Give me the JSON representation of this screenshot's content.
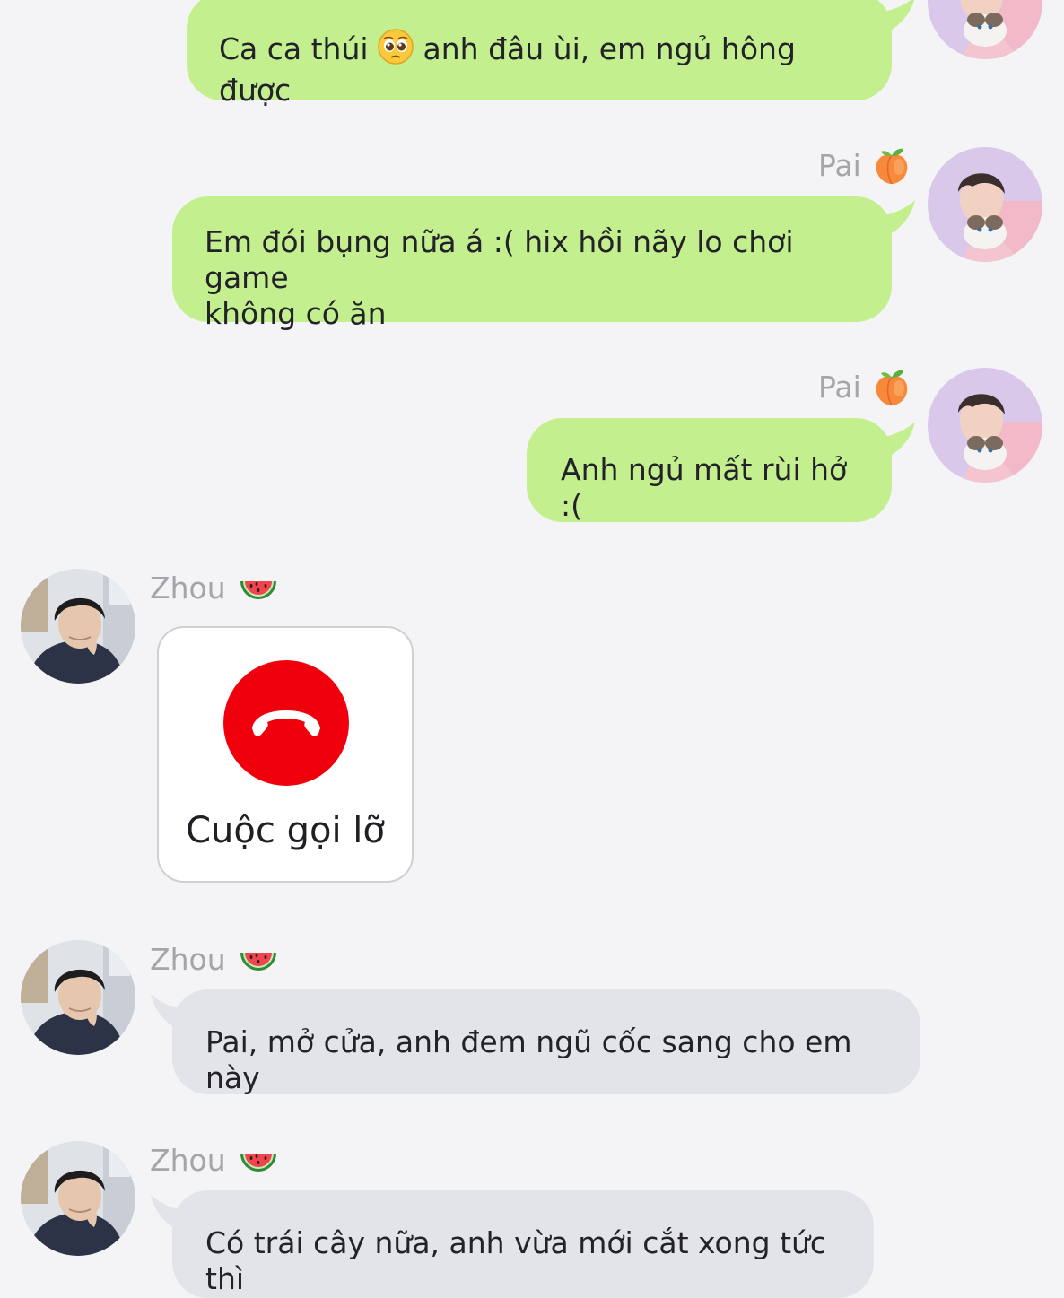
{
  "messages": [
    {
      "side": "outgoing",
      "text_before_emoji": "Ca ca thúi ",
      "emoji": "pleading-face-emoji",
      "text_after_emoji": " anh đâu ùi, em ngủ hông được"
    },
    {
      "side": "outgoing",
      "sender_name": "Pai",
      "sender_emoji": "peach-emoji",
      "text": "Em đói bụng nữa á :( hix hồi nãy lo chơi game\nkhông có ăn"
    },
    {
      "side": "outgoing",
      "sender_name": "Pai",
      "sender_emoji": "peach-emoji",
      "text": "Anh ngủ mất rùi hở :("
    },
    {
      "side": "incoming",
      "sender_name": "Zhou",
      "sender_emoji": "watermelon-emoji",
      "type": "missed_call",
      "call_label": "Cuộc gọi lỡ",
      "call_icon": "phone-hangup-icon",
      "call_icon_color": "#f0000c"
    },
    {
      "side": "incoming",
      "sender_name": "Zhou",
      "sender_emoji": "watermelon-emoji",
      "text": "Pai, mở cửa, anh đem ngũ cốc sang cho em này"
    },
    {
      "side": "incoming",
      "sender_name": "Zhou",
      "sender_emoji": "watermelon-emoji",
      "text": "Có trái cây nữa, anh vừa mới cắt xong tức thì"
    }
  ],
  "colors": {
    "background": "#f4f4f6",
    "outgoing_bubble": "#c3ef8f",
    "incoming_bubble": "#e3e4ea",
    "sender_name": "#a4a4aa",
    "text": "#222228"
  }
}
